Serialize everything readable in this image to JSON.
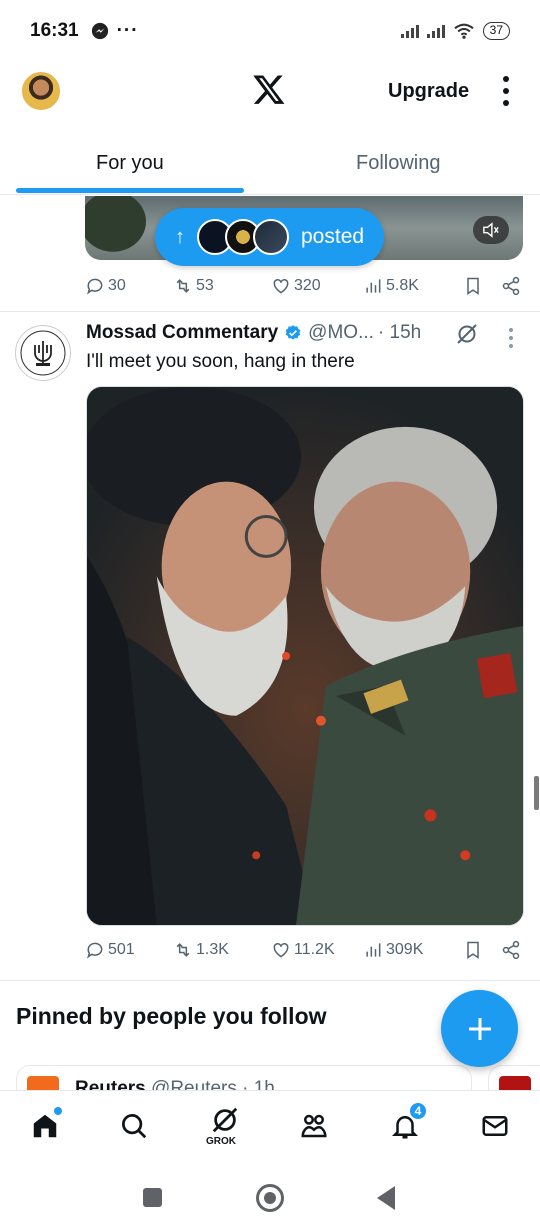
{
  "status_bar": {
    "time": "16:31",
    "battery": "37"
  },
  "header": {
    "upgrade_label": "Upgrade"
  },
  "tabs": [
    {
      "label": "For you",
      "active": true
    },
    {
      "label": "Following",
      "active": false
    }
  ],
  "posted_pill": {
    "label": "posted"
  },
  "prev_tweet": {
    "stats": {
      "replies": "30",
      "reposts": "53",
      "likes": "320",
      "views": "5.8K"
    }
  },
  "tweet": {
    "name": "Mossad Commentary",
    "handle": "@MO...",
    "time": "· 15h",
    "text": "I'll meet you soon, hang in there",
    "stats": {
      "replies": "501",
      "reposts": "1.3K",
      "likes": "11.2K",
      "views": "309K"
    }
  },
  "pinned": {
    "title": "Pinned by people you follow",
    "card_name": "Reuters",
    "card_handle": "@Reuters · 1h"
  },
  "nav": {
    "grok_label": "GROK",
    "notifications_badge": "4"
  },
  "colors": {
    "accent": "#1d9bf0",
    "text": "#0f1419",
    "muted": "#536471"
  }
}
